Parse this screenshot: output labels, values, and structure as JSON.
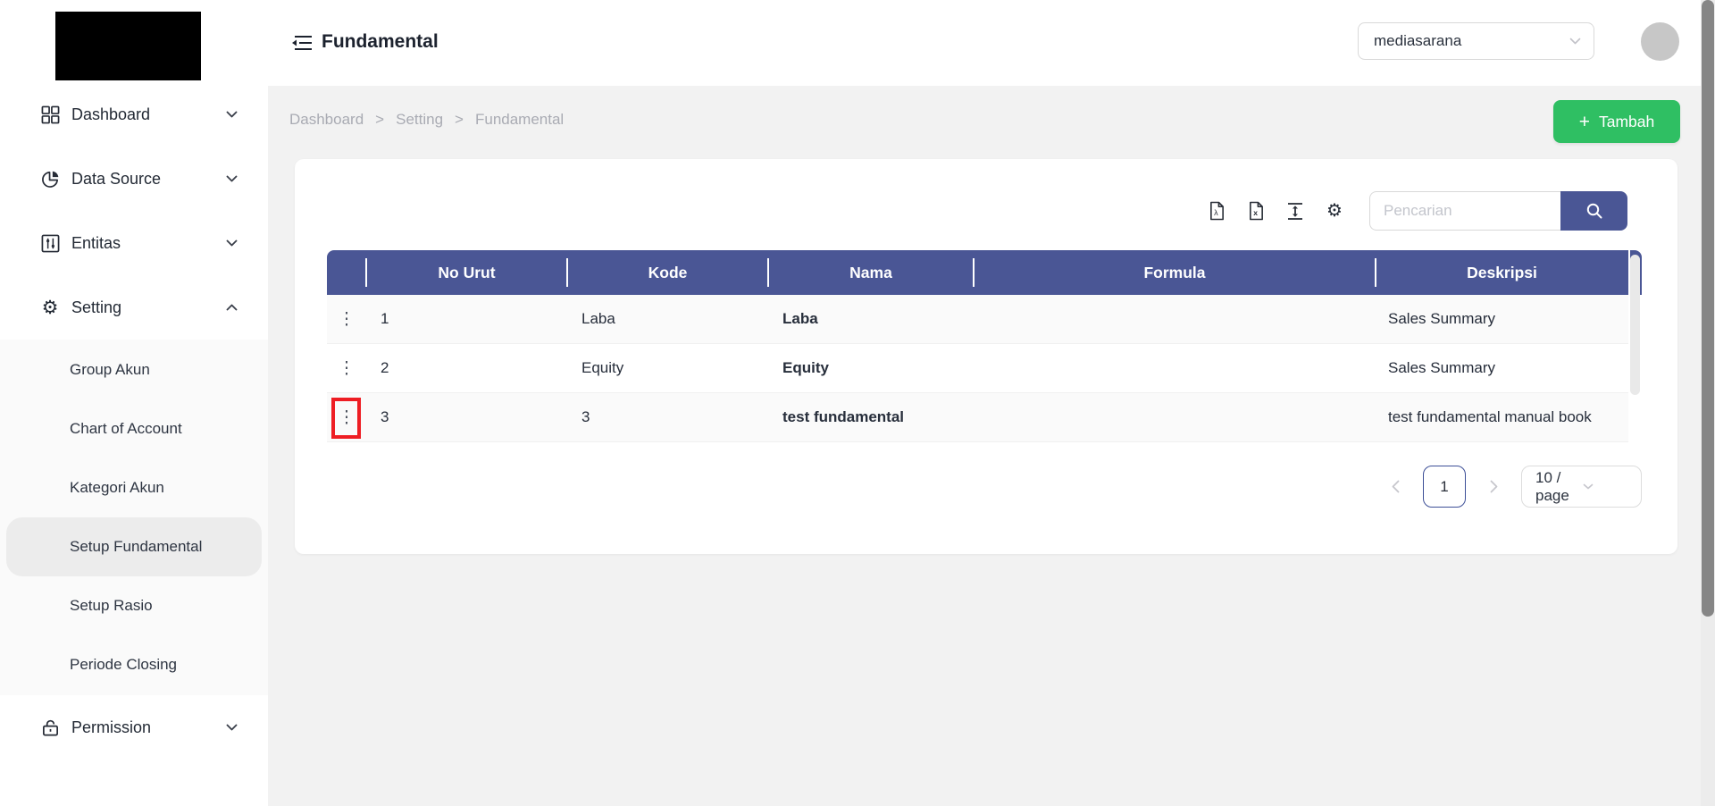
{
  "sidebar": {
    "items": [
      {
        "label": "Dashboard",
        "icon": "grid-icon"
      },
      {
        "label": "Data Source",
        "icon": "pie-chart-icon"
      },
      {
        "label": "Entitas",
        "icon": "sliders-icon"
      },
      {
        "label": "Setting",
        "icon": "gear-icon",
        "expanded": true
      }
    ],
    "submenu": [
      "Group Akun",
      "Chart of Account",
      "Kategori Akun",
      "Setup Fundamental",
      "Setup Rasio",
      "Periode Closing"
    ],
    "active_submenu": "Setup Fundamental",
    "permission": {
      "label": "Permission",
      "icon": "unlock-icon"
    }
  },
  "header": {
    "title": "Fundamental",
    "tenant_select": {
      "value": "mediasarana"
    }
  },
  "breadcrumb": {
    "items": [
      "Dashboard",
      "Setting",
      "Fundamental"
    ],
    "separator": ">"
  },
  "actions": {
    "add_label": "Tambah",
    "add_plus": "+"
  },
  "toolbar": {
    "icons": [
      "export-pdf",
      "export-excel",
      "column-height",
      "column-settings"
    ],
    "search_placeholder": "Pencarian"
  },
  "table": {
    "columns": [
      {
        "key": "actions",
        "label": ""
      },
      {
        "key": "no_urut",
        "label": "No Urut"
      },
      {
        "key": "kode",
        "label": "Kode"
      },
      {
        "key": "nama",
        "label": "Nama"
      },
      {
        "key": "formula",
        "label": "Formula"
      },
      {
        "key": "deskripsi",
        "label": "Deskripsi"
      }
    ],
    "rows": [
      {
        "no_urut": "1",
        "kode": "Laba",
        "nama": "Laba",
        "formula": "",
        "deskripsi": "Sales Summary"
      },
      {
        "no_urut": "2",
        "kode": "Equity",
        "nama": "Equity",
        "formula": "",
        "deskripsi": "Sales Summary"
      },
      {
        "no_urut": "3",
        "kode": "3",
        "nama": "test fundamental",
        "formula": "",
        "deskripsi": "test fundamental manual book"
      }
    ],
    "kebab_glyph": "⋮"
  },
  "pagination": {
    "current": "1",
    "page_size": "10 / page"
  },
  "colors": {
    "primary_blue": "#4a5695",
    "accent_green": "#2fbf63",
    "annotation_red": "#ee1d23",
    "row_stripe": "#fafafa",
    "page_bg": "#f2f2f2"
  }
}
